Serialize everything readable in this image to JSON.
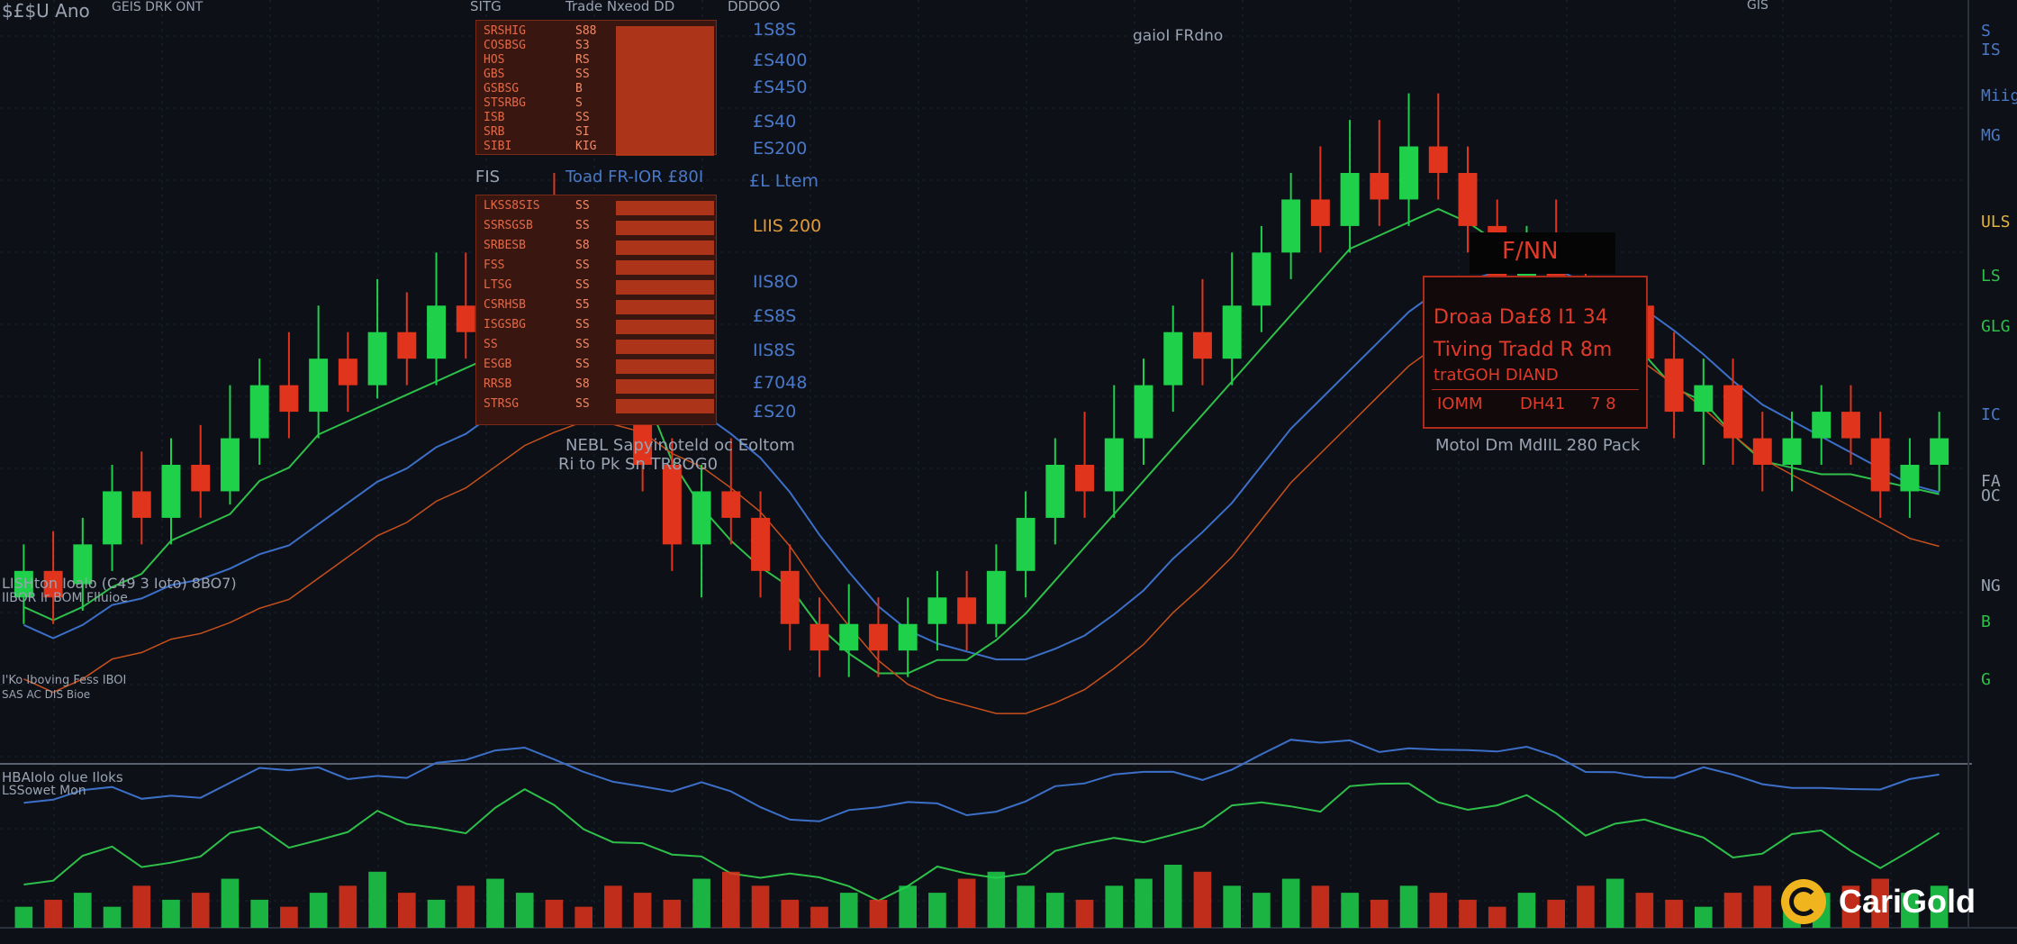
{
  "header": {
    "ticker": "$£$U Ano",
    "subtitle": "GEIS DRK ONT",
    "panel_title": "SITG",
    "center_label": "Trade Nxeod DD",
    "center_label_right": "DDDOO",
    "top_right": "GIS"
  },
  "order_book_top": {
    "rows": [
      {
        "label": "SRSHIG",
        "qty": "S88"
      },
      {
        "label": "COSBSG",
        "qty": "S3"
      },
      {
        "label": "HOS",
        "qty": "RS"
      },
      {
        "label": "GBS",
        "qty": "SS"
      },
      {
        "label": "GSBSG",
        "qty": "B"
      },
      {
        "label": "STSRBG",
        "qty": "S"
      },
      {
        "label": "ISB",
        "qty": "SS"
      },
      {
        "label": "SRB",
        "qty": "SI"
      },
      {
        "label": "SIBI",
        "qty": "KIG"
      }
    ]
  },
  "order_book_bottom": {
    "rows": [
      {
        "label": "LKSS8SIS",
        "qty": "SS"
      },
      {
        "label": "SSRSGSB",
        "qty": "SS"
      },
      {
        "label": "SRBESB",
        "qty": "S8"
      },
      {
        "label": "FSS",
        "qty": "SS"
      },
      {
        "label": "LTSG",
        "qty": "SS"
      },
      {
        "label": "CSRHSB",
        "qty": "S5"
      },
      {
        "label": "ISGSBG",
        "qty": "SS"
      },
      {
        "label": "SS",
        "qty": "SS"
      },
      {
        "label": "ESGB",
        "qty": "SS"
      },
      {
        "label": "RRSB",
        "qty": "S8"
      },
      {
        "label": "STRSG",
        "qty": "SS"
      }
    ]
  },
  "price_column": [
    "1S8S",
    "£S400",
    "£S450",
    "£S40",
    "ES200",
    "£L Ltem",
    "LIIS 200",
    "IIS8O",
    "£S8S",
    "IIS8S",
    "£7048",
    "£S20"
  ],
  "labels": {
    "mid_left_a": "FIS",
    "mid_left_b": "Toad FR-IOR £80I",
    "book_note_a": "NEBL Sapyinoteld  oc Eoltom",
    "book_note_b": "Ri to Pk Sn TR8OG0",
    "indicator_a": "LISHton Ioalo (C49 3 Ioto) 8BO7)",
    "indicator_b": "IIBOR   Ir BOM Flluioe",
    "indicator_c": "I'Ko Iboving Fess IBOI",
    "indicator_d": "SAS AC DIS Bioe",
    "volume_title": "HBAIolo olue Iloks",
    "volume_sub": "LSSowet Mon",
    "top_center": "gaioI FRdno",
    "right_note": "Motol Dm MdIIL 280 Pack"
  },
  "tooltip": {
    "header": "F/NN",
    "line1": "Droaa  Da£8  I1 34",
    "line2": "Tiving  Tradd  R 8m",
    "line3": "tratGOH DIAND",
    "line4_a": "IOMM",
    "line4_b": "DH41",
    "line4_c": "7 8"
  },
  "right_axis": [
    "S IS",
    "Miig",
    "MG",
    "ULS",
    "LS",
    "GLG",
    "IC",
    "FA",
    "OC",
    "NG",
    "B",
    "G"
  ],
  "logo": {
    "text": "CariGold"
  },
  "colors": {
    "up": "#1fd04a",
    "down": "#e0341c",
    "blue_line": "#3c6fc8",
    "green_line": "#2ec04a",
    "orange_line": "#c8501c",
    "background": "#0d1117"
  },
  "chart_data": {
    "type": "candlestick",
    "title": "",
    "xlabel": "",
    "ylabel": "",
    "grid": true,
    "series": [
      {
        "name": "",
        "values": [
          [
            62,
            64,
            66,
            60
          ],
          [
            64,
            62,
            67,
            60
          ],
          [
            63,
            66,
            68,
            61
          ],
          [
            66,
            70,
            72,
            64
          ],
          [
            70,
            68,
            73,
            66
          ],
          [
            68,
            72,
            74,
            66
          ],
          [
            72,
            70,
            75,
            68
          ],
          [
            70,
            74,
            78,
            69
          ],
          [
            74,
            78,
            80,
            72
          ],
          [
            78,
            76,
            82,
            74
          ],
          [
            76,
            80,
            84,
            74
          ],
          [
            80,
            78,
            82,
            76
          ],
          [
            78,
            82,
            86,
            77
          ],
          [
            82,
            80,
            85,
            78
          ],
          [
            80,
            84,
            88,
            78
          ],
          [
            84,
            82,
            88,
            80
          ],
          [
            82,
            86,
            90,
            80
          ],
          [
            86,
            90,
            92,
            84
          ],
          [
            90,
            88,
            94,
            86
          ],
          [
            88,
            84,
            90,
            82
          ],
          [
            84,
            78,
            86,
            76
          ],
          [
            78,
            72,
            80,
            70
          ],
          [
            72,
            66,
            74,
            64
          ],
          [
            66,
            70,
            72,
            62
          ],
          [
            70,
            68,
            74,
            66
          ],
          [
            68,
            64,
            70,
            62
          ],
          [
            64,
            60,
            66,
            58
          ],
          [
            60,
            58,
            62,
            56
          ],
          [
            58,
            60,
            63,
            56
          ],
          [
            60,
            58,
            62,
            56
          ],
          [
            58,
            60,
            62,
            56
          ],
          [
            60,
            62,
            64,
            58
          ],
          [
            62,
            60,
            64,
            58
          ],
          [
            60,
            64,
            66,
            59
          ],
          [
            64,
            68,
            70,
            62
          ],
          [
            68,
            72,
            74,
            66
          ],
          [
            72,
            70,
            76,
            68
          ],
          [
            70,
            74,
            78,
            68
          ],
          [
            74,
            78,
            80,
            72
          ],
          [
            78,
            82,
            84,
            76
          ],
          [
            82,
            80,
            86,
            78
          ],
          [
            80,
            84,
            88,
            78
          ],
          [
            84,
            88,
            90,
            82
          ],
          [
            88,
            92,
            94,
            86
          ],
          [
            92,
            90,
            96,
            88
          ],
          [
            90,
            94,
            98,
            88
          ],
          [
            94,
            92,
            98,
            90
          ],
          [
            92,
            96,
            100,
            90
          ],
          [
            96,
            94,
            100,
            92
          ],
          [
            94,
            90,
            96,
            88
          ],
          [
            90,
            86,
            92,
            84
          ],
          [
            86,
            88,
            90,
            82
          ],
          [
            88,
            86,
            92,
            84
          ],
          [
            86,
            82,
            88,
            80
          ],
          [
            82,
            84,
            86,
            80
          ],
          [
            84,
            80,
            86,
            78
          ],
          [
            80,
            76,
            82,
            74
          ],
          [
            76,
            78,
            80,
            72
          ],
          [
            78,
            74,
            80,
            72
          ],
          [
            74,
            72,
            76,
            70
          ],
          [
            72,
            74,
            76,
            70
          ],
          [
            74,
            76,
            78,
            72
          ],
          [
            76,
            74,
            78,
            72
          ],
          [
            74,
            70,
            76,
            68
          ],
          [
            70,
            72,
            74,
            68
          ],
          [
            72,
            74,
            76,
            70
          ]
        ]
      }
    ],
    "volume": [
      3,
      4,
      5,
      3,
      6,
      4,
      5,
      7,
      4,
      3,
      5,
      6,
      8,
      5,
      4,
      6,
      7,
      5,
      4,
      3,
      6,
      5,
      4,
      7,
      8,
      6,
      4,
      3,
      5,
      4,
      6,
      5,
      7,
      8,
      6,
      5,
      4,
      6,
      7,
      9,
      8,
      6,
      5,
      7,
      6,
      5,
      4,
      6,
      5,
      4,
      3,
      5,
      4,
      6,
      7,
      5,
      4,
      3,
      5,
      6,
      4,
      5,
      6,
      7,
      5,
      6
    ]
  }
}
